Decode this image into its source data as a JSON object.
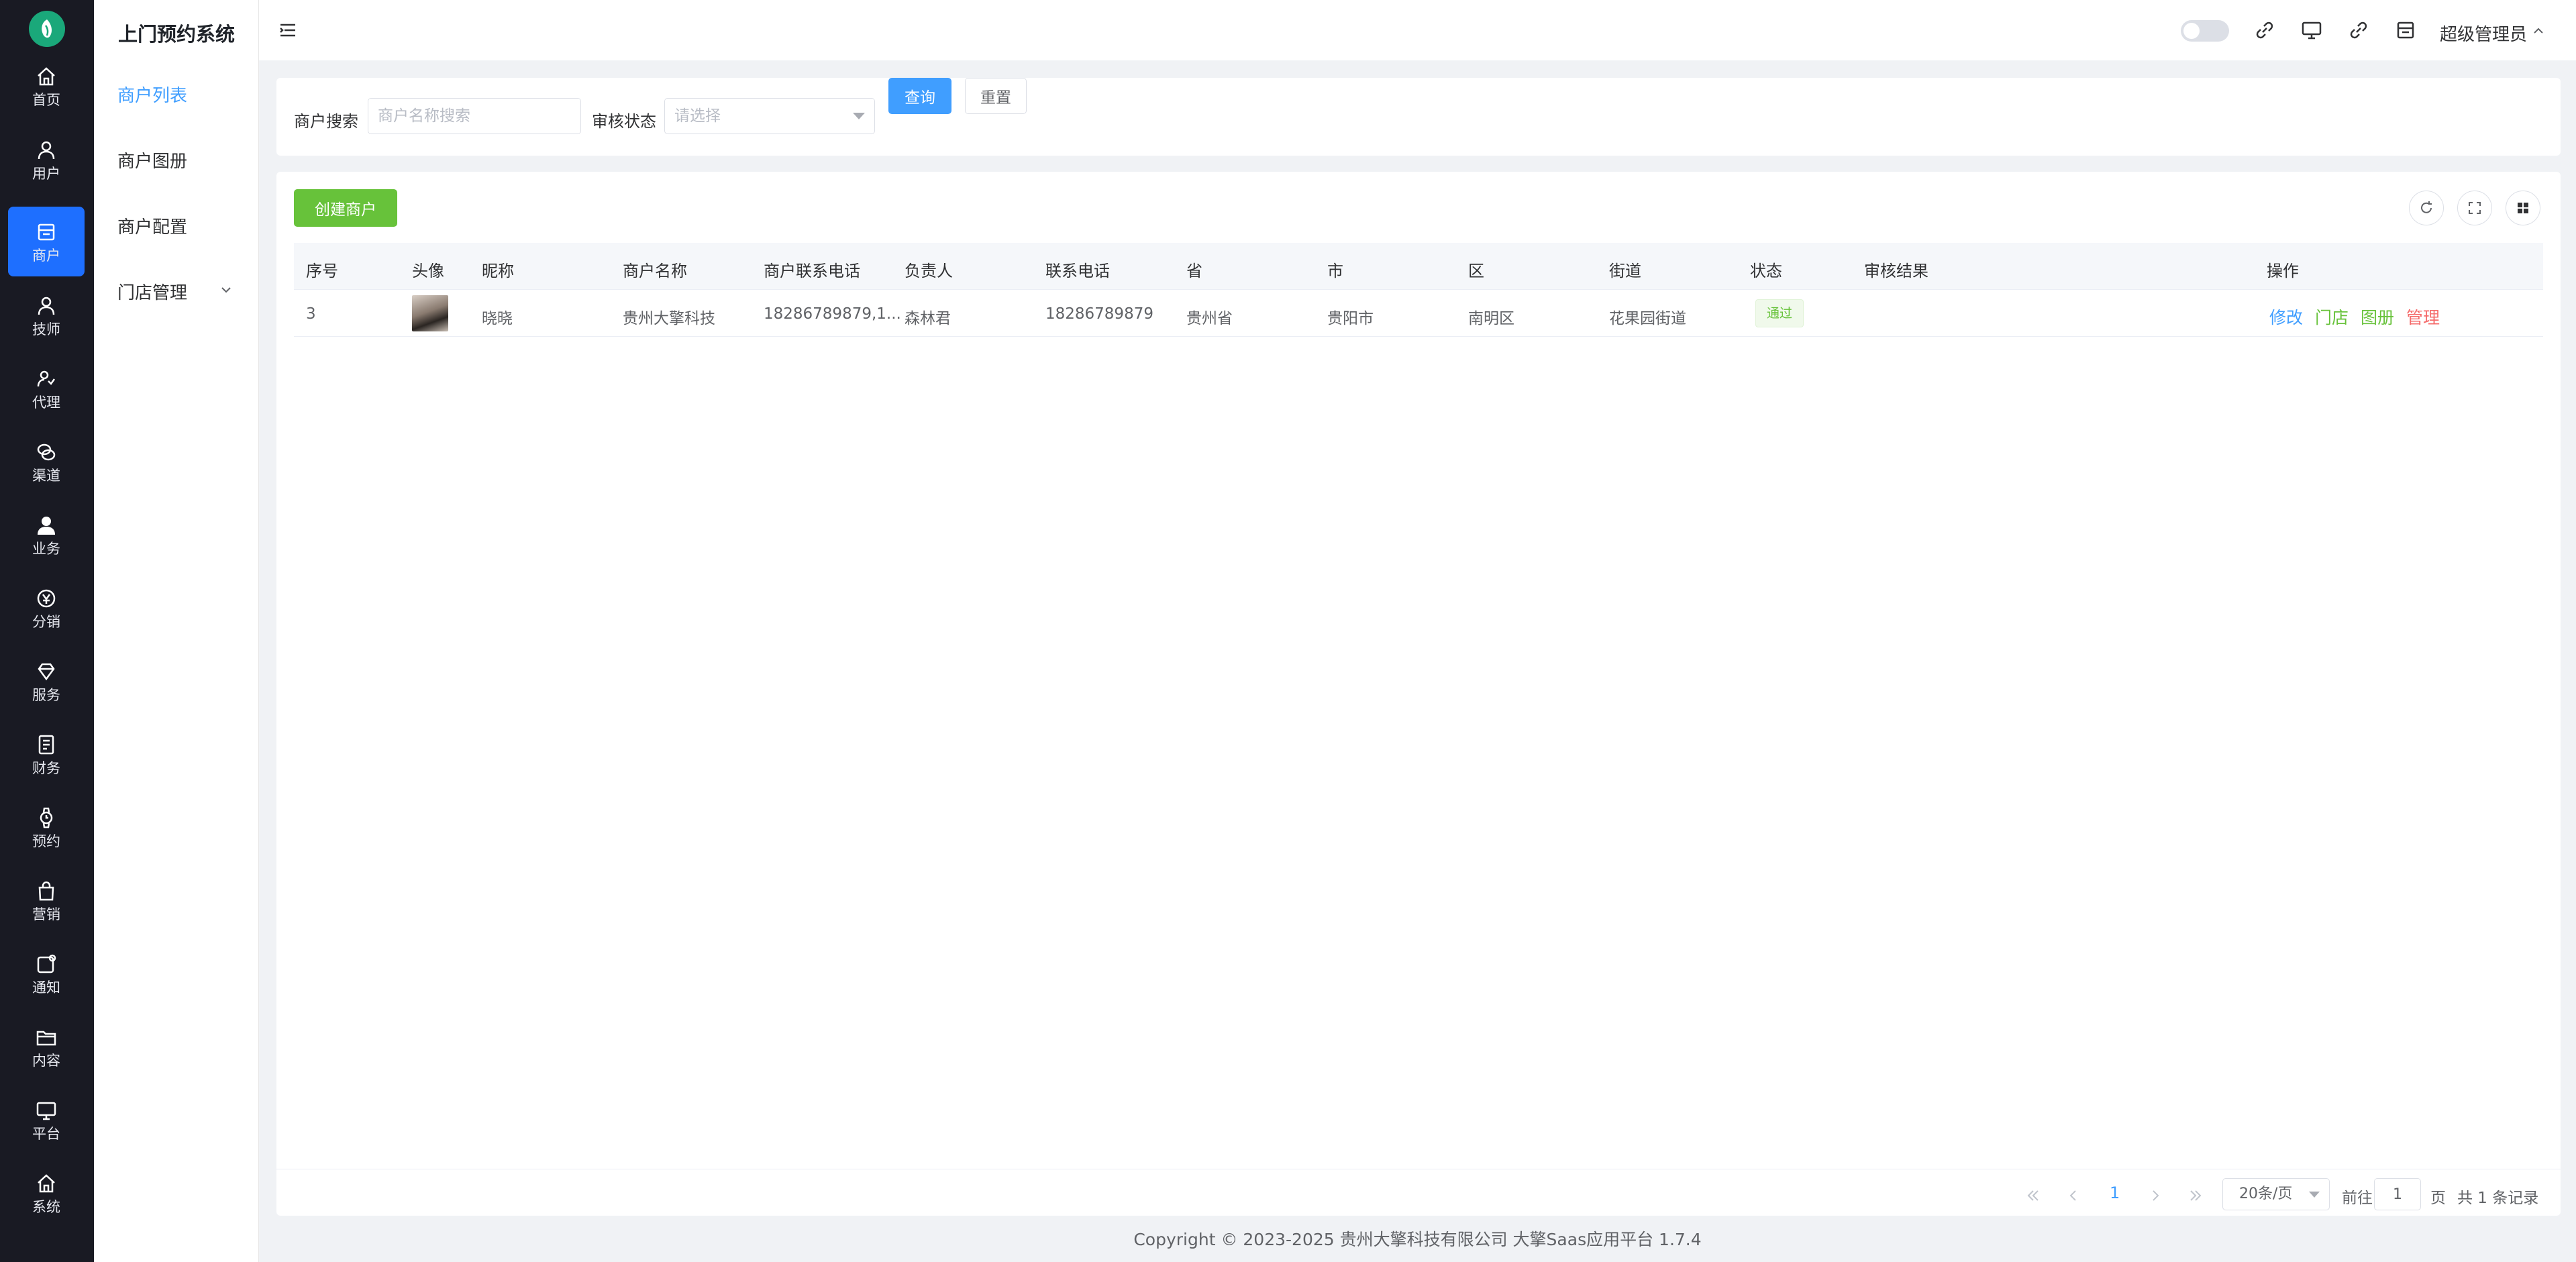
{
  "app": {
    "title": "上门预约系统"
  },
  "rail": {
    "items": [
      {
        "label": "首页",
        "icon": "home-icon"
      },
      {
        "label": "用户",
        "icon": "user-icon"
      },
      {
        "label": "商户",
        "icon": "store-icon",
        "active": true
      },
      {
        "label": "技师",
        "icon": "technician-icon"
      },
      {
        "label": "代理",
        "icon": "agent-icon"
      },
      {
        "label": "渠道",
        "icon": "channel-icon"
      },
      {
        "label": "业务",
        "icon": "business-icon"
      },
      {
        "label": "分销",
        "icon": "distribution-icon"
      },
      {
        "label": "服务",
        "icon": "diamond-icon"
      },
      {
        "label": "财务",
        "icon": "ledger-icon"
      },
      {
        "label": "预约",
        "icon": "watch-icon"
      },
      {
        "label": "营销",
        "icon": "bag-icon"
      },
      {
        "label": "通知",
        "icon": "notification-icon"
      },
      {
        "label": "内容",
        "icon": "folder-icon"
      },
      {
        "label": "平台",
        "icon": "monitor-icon"
      },
      {
        "label": "系统",
        "icon": "system-home-icon"
      }
    ]
  },
  "submenu": {
    "items": [
      {
        "label": "商户列表",
        "active": true
      },
      {
        "label": "商户图册"
      },
      {
        "label": "商户配置"
      },
      {
        "label": "门店管理",
        "expandable": true
      }
    ]
  },
  "header": {
    "user": "超级管理员",
    "icons": [
      "theme-toggle",
      "link-icon",
      "monitor-icon",
      "link-icon",
      "store-icon"
    ]
  },
  "search": {
    "merchant_label": "商户搜索",
    "merchant_placeholder": "商户名称搜索",
    "status_label": "审核状态",
    "status_placeholder": "请选择",
    "query_button": "查询",
    "reset_button": "重置"
  },
  "toolbar": {
    "create_button": "创建商户"
  },
  "table": {
    "columns": [
      "序号",
      "头像",
      "昵称",
      "商户名称",
      "商户联系电话",
      "负责人",
      "联系电话",
      "省",
      "市",
      "区",
      "街道",
      "状态",
      "审核结果",
      "操作"
    ],
    "rows": [
      {
        "index": "3",
        "nickname": "晓晓",
        "merchant_name": "贵州大擎科技",
        "merchant_phone": "18286789879,1...",
        "owner": "森林君",
        "phone": "18286789879",
        "province": "贵州省",
        "city": "贵阳市",
        "district": "南明区",
        "street": "花果园街道",
        "status": "通过",
        "review_result": "",
        "actions": {
          "edit": "修改",
          "store": "门店",
          "album": "图册",
          "manage": "管理"
        }
      }
    ]
  },
  "pagination": {
    "current_page": "1",
    "page_size": "20条/页",
    "goto_prefix": "前往",
    "goto_value": "1",
    "goto_suffix": "页",
    "total": "共 1 条记录"
  },
  "colors": {
    "rail_bg": "#191a23",
    "rail_active": "#1e6fff",
    "primary": "#409eff",
    "success": "#67c23a",
    "danger": "#f56c6c"
  },
  "footer": {
    "text": "Copyright © 2023-2025 贵州大擎科技有限公司  大擎Saas应用平台 1.7.4"
  }
}
